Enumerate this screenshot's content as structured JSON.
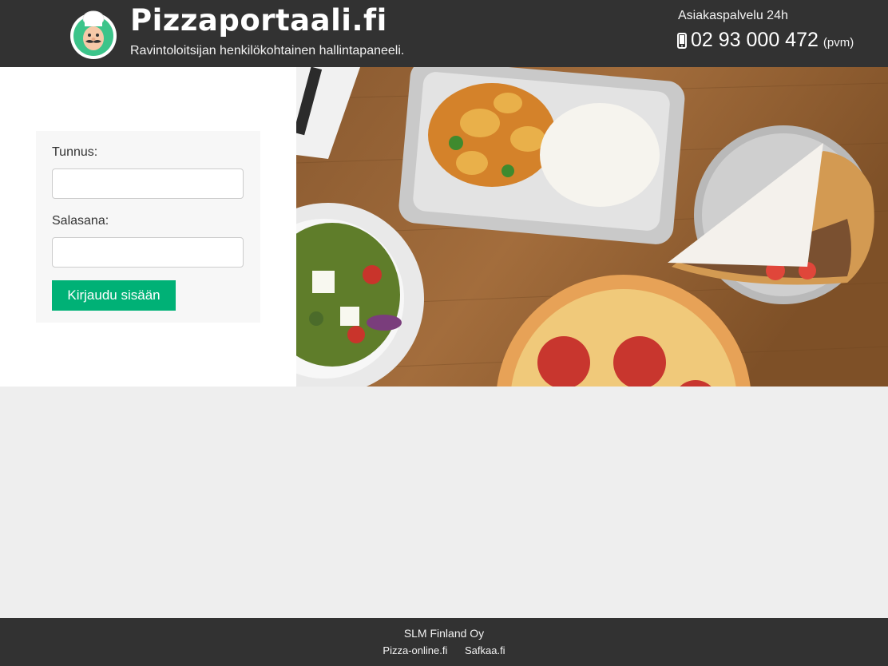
{
  "header": {
    "brand": "Pizzaportaali.fi",
    "tagline": "Ravintoloitsijan henkilökohtainen hallintapaneeli.",
    "support_label": "Asiakaspalvelu 24h",
    "phone_number": "02 93 000 472",
    "phone_note": "(pvm)",
    "logo_icon": "chef-mascot-icon",
    "phone_icon": "mobile-phone-icon"
  },
  "login": {
    "username_label": "Tunnus:",
    "username_value": "",
    "password_label": "Salasana:",
    "password_value": "",
    "submit_label": "Kirjaudu sisään"
  },
  "footer": {
    "company": "SLM Finland Oy",
    "links": [
      "Pizza-online.fi",
      "Safkaa.fi"
    ]
  },
  "colors": {
    "header_bg": "#323232",
    "accent": "#00b176",
    "page_bg": "#eeeeee",
    "login_box_bg": "#f7f7f7"
  }
}
